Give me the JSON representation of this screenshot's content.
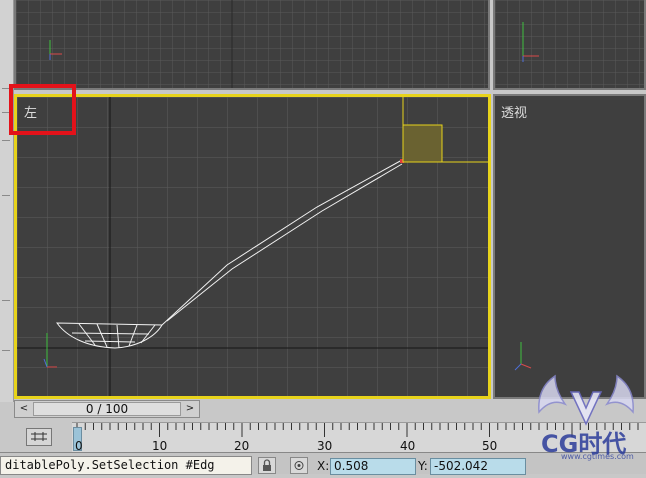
{
  "viewports": {
    "left_label": "左",
    "perspective_label": "透视"
  },
  "time_slider": {
    "position_text": "0 / 100",
    "left_arrow": "<",
    "right_arrow": ">"
  },
  "track_bar": {
    "ticks": [
      "0",
      "10",
      "20",
      "30",
      "40",
      "50"
    ]
  },
  "status": {
    "listener_text": "ditablePoly.SetSelection #Edg",
    "x_label": "X:",
    "x_value": "0.508",
    "y_label": "Y:",
    "y_value": "-502.042"
  },
  "watermark": {
    "text": "CG时代",
    "subtext": "www.cgtimes.com"
  },
  "colors": {
    "active_border": "#e7d31b",
    "highlight": "#e3121a",
    "viewport_bg": "#3f3f3f"
  }
}
